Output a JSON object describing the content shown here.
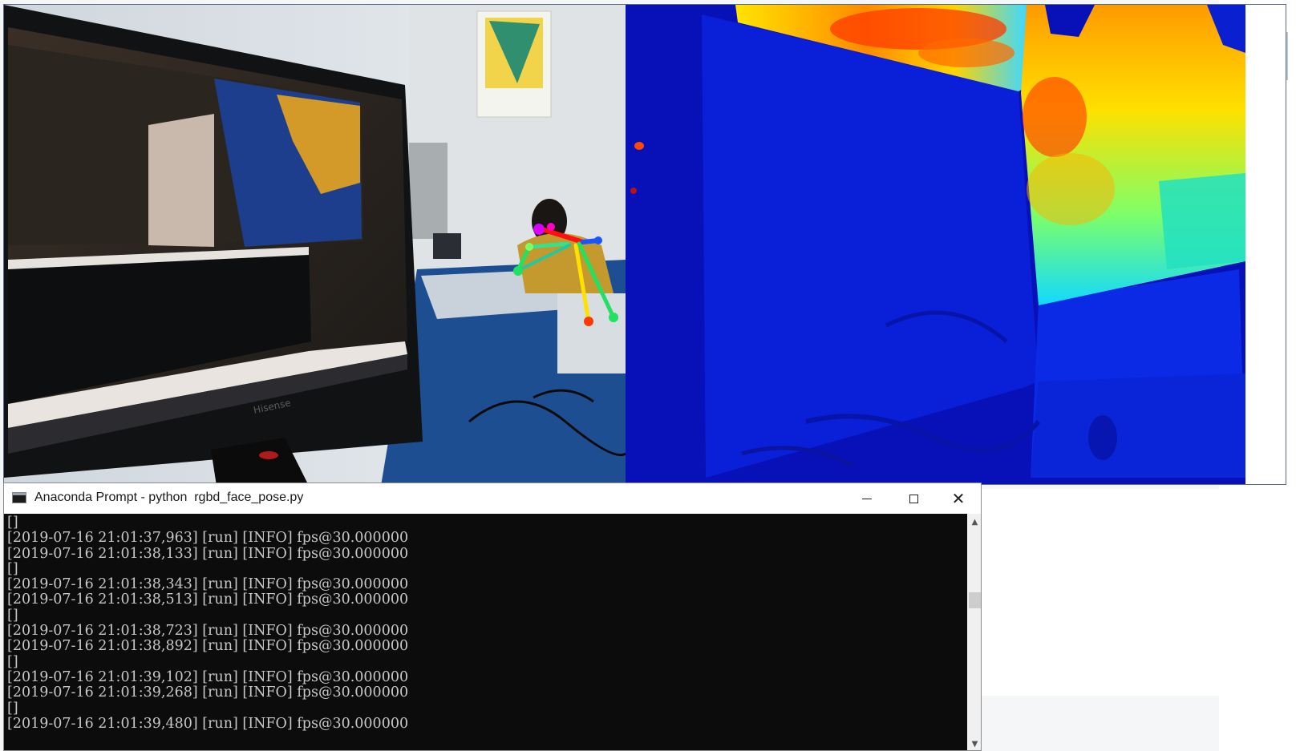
{
  "console": {
    "title": "Anaconda Prompt - python  rgbd_face_pose.py",
    "lines": [
      "[]",
      "[2019-07-16 21:01:37,963] [run] [INFO] fps@30.000000",
      "[2019-07-16 21:01:38,133] [run] [INFO] fps@30.000000",
      "[]",
      "[2019-07-16 21:01:38,343] [run] [INFO] fps@30.000000",
      "[2019-07-16 21:01:38,513] [run] [INFO] fps@30.000000",
      "[]",
      "[2019-07-16 21:01:38,723] [run] [INFO] fps@30.000000",
      "[2019-07-16 21:01:38,892] [run] [INFO] fps@30.000000",
      "[]",
      "[2019-07-16 21:01:39,102] [run] [INFO] fps@30.000000",
      "[2019-07-16 21:01:39,268] [run] [INFO] fps@30.000000",
      "[]",
      "[2019-07-16 21:01:39,480] [run] [INFO] fps@30.000000"
    ],
    "controls": {
      "minimize_icon": "minimize-icon",
      "maximize_icon": "maximize-icon",
      "close_icon": "close-icon",
      "close_glyph": "✕"
    }
  },
  "viewer": {
    "monitor_brand": "Hisense",
    "colors": {
      "depth_far": "#0a14c8",
      "depth_near": "#ff2a00",
      "skeleton_head": "#d800ff",
      "skeleton_left": "#00ff5a",
      "skeleton_right": "#ffe000"
    }
  },
  "scrollbar": {
    "up_glyph": "▲",
    "down_glyph": "▼"
  }
}
